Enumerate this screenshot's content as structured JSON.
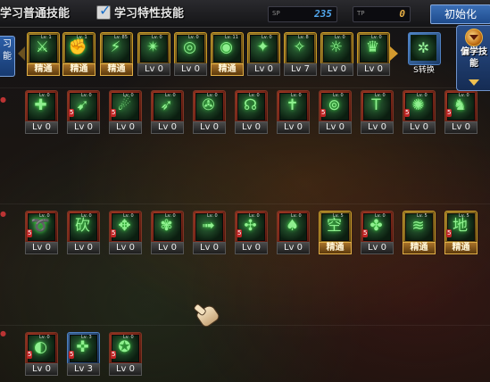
{
  "header": {
    "tab_normal": "学习普通技能",
    "tab_special": "学习特性技能",
    "sp_label": "SP",
    "sp_value": "235",
    "tp_label": "TP",
    "tp_value": "0",
    "reset_button": "初始化"
  },
  "left_tab": {
    "label": "习能"
  },
  "change_button": {
    "label": "S转换"
  },
  "side_button": {
    "label": "偏学技能"
  },
  "colors": {
    "accent": "#2d5fa8",
    "points_blue": "#53a9f0",
    "master_gold": "#e2b047",
    "frame_red": "#c2432a"
  },
  "rows": [
    {
      "name": "top",
      "skills": [
        {
          "glyph": "⚔",
          "level_text": "精通",
          "master": true,
          "frame": "gold",
          "tag": "Lv. 1"
        },
        {
          "glyph": "✊",
          "level_text": "精通",
          "master": true,
          "frame": "gold",
          "tag": "Lv. 1"
        },
        {
          "glyph": "⚡",
          "level_text": "精通",
          "master": true,
          "frame": "gold",
          "tag": "Lv. 85"
        },
        {
          "glyph": "✴",
          "level_text": "Lv 0",
          "master": false,
          "frame": "gold",
          "tag": "Lv. 0"
        },
        {
          "glyph": "◎",
          "level_text": "Lv 0",
          "master": false,
          "frame": "gold",
          "tag": "Lv. 0"
        },
        {
          "glyph": "◉",
          "level_text": "精通",
          "master": true,
          "frame": "gold",
          "tag": "Lv. 11"
        },
        {
          "glyph": "✦",
          "level_text": "Lv 0",
          "master": false,
          "frame": "gold",
          "tag": "Lv. 0"
        },
        {
          "glyph": "✧",
          "level_text": "Lv 7",
          "master": false,
          "frame": "gold",
          "tag": "Lv. 8"
        },
        {
          "glyph": "☼",
          "level_text": "Lv 0",
          "master": false,
          "frame": "gold",
          "tag": "Lv. 0"
        },
        {
          "glyph": "♛",
          "level_text": "Lv 0",
          "master": false,
          "frame": "gold",
          "tag": "Lv. 0"
        }
      ]
    },
    {
      "name": "second",
      "skills": [
        {
          "glyph": "✚",
          "level_text": "Lv 0",
          "tag": "Lv. 0"
        },
        {
          "glyph": "➹",
          "level_text": "Lv 0",
          "tag": "Lv. 0",
          "lock": "5"
        },
        {
          "glyph": "☄",
          "level_text": "Lv 0",
          "tag": "Lv. 0",
          "lock": "5"
        },
        {
          "glyph": "➶",
          "level_text": "Lv 0",
          "tag": "Lv. 0"
        },
        {
          "glyph": "✇",
          "level_text": "Lv 0",
          "tag": "Lv. 0"
        },
        {
          "glyph": "☊",
          "level_text": "Lv 0",
          "tag": "Lv. 0"
        },
        {
          "glyph": "✝",
          "level_text": "Lv 0",
          "tag": "Lv. 0"
        },
        {
          "glyph": "⊚",
          "level_text": "Lv 0",
          "tag": "Lv. 0",
          "lock": "5"
        },
        {
          "glyph": "T",
          "level_text": "Lv 0",
          "tag": "Lv. 0"
        },
        {
          "glyph": "✺",
          "level_text": "Lv 0",
          "tag": "Lv. 0",
          "lock": "5"
        },
        {
          "glyph": "♞",
          "level_text": "Lv 0",
          "tag": "Lv. 0",
          "lock": "5"
        }
      ]
    },
    {
      "name": "third",
      "skills": [
        {
          "glyph": "➰",
          "level_text": "Lv 0",
          "tag": "Lv. 0",
          "lock": "5"
        },
        {
          "glyph": "砍",
          "level_text": "Lv 0",
          "tag": "Lv. 0"
        },
        {
          "glyph": "✥",
          "level_text": "Lv 0",
          "tag": "Lv. 0",
          "lock": "5"
        },
        {
          "glyph": "✾",
          "level_text": "Lv 0",
          "tag": "Lv. 0"
        },
        {
          "glyph": "➟",
          "level_text": "Lv 0",
          "tag": "Lv. 0"
        },
        {
          "glyph": "✣",
          "level_text": "Lv 0",
          "tag": "Lv. 0",
          "lock": "5"
        },
        {
          "glyph": "♠",
          "level_text": "Lv 0",
          "tag": "Lv. 0"
        },
        {
          "glyph": "空",
          "level_text": "精通",
          "master": true,
          "frame": "gold",
          "tag": "Lv. 5"
        },
        {
          "glyph": "✤",
          "level_text": "Lv 0",
          "tag": "Lv. 0",
          "lock": "5"
        },
        {
          "glyph": "≋",
          "level_text": "精通",
          "master": true,
          "frame": "gold",
          "tag": "Lv. 5"
        },
        {
          "glyph": "地",
          "level_text": "精通",
          "master": true,
          "frame": "gold",
          "tag": "Lv. 5",
          "lock": "5"
        }
      ]
    },
    {
      "name": "bottom",
      "skills": [
        {
          "glyph": "◐",
          "level_text": "Lv 0",
          "tag": "Lv. 0",
          "lock": "5"
        },
        {
          "glyph": "✜",
          "level_text": "Lv 3",
          "tag": "Lv. 3",
          "lock": "5",
          "frame": "blue"
        },
        {
          "glyph": "✪",
          "level_text": "Lv 0",
          "tag": "Lv. 0",
          "lock": "5"
        }
      ]
    }
  ]
}
